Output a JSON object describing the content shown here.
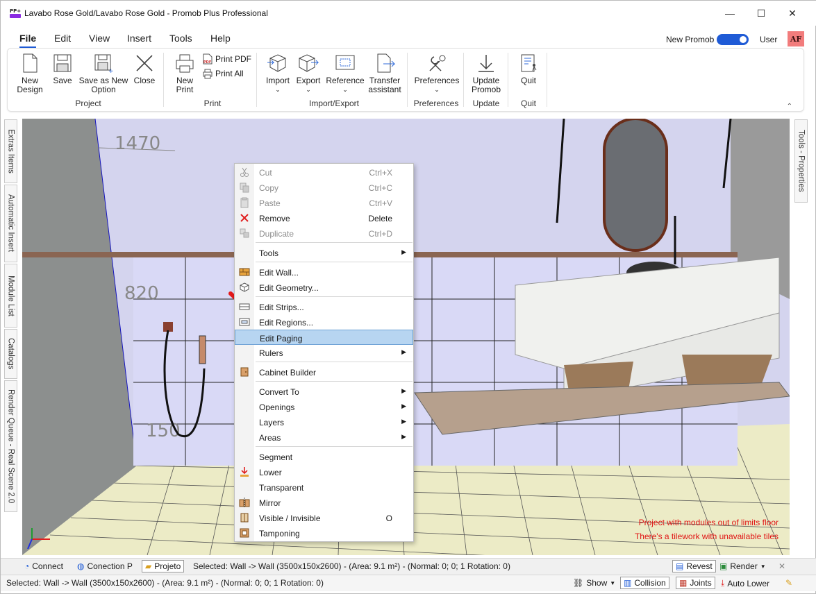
{
  "window": {
    "title": "Lavabo Rose Gold/Lavabo Rose Gold - Promob Plus Professional",
    "controls": {
      "minimize": "—",
      "maximize": "☐",
      "close": "✕"
    }
  },
  "menubar": {
    "items": [
      "File",
      "Edit",
      "View",
      "Insert",
      "Tools",
      "Help"
    ],
    "active": "File",
    "toggle_label": "New Promob",
    "toggle_on": true,
    "user_label": "User",
    "avatar_initials": "AF"
  },
  "ribbon": {
    "project": {
      "label": "Project",
      "new_design": [
        "New",
        "Design"
      ],
      "save": "Save",
      "save_as": [
        "Save as New",
        "Option"
      ],
      "close": "Close"
    },
    "print": {
      "label": "Print",
      "new_print": [
        "New",
        "Print"
      ],
      "print_pdf": "Print PDF",
      "print_all": "Print All"
    },
    "import_export": {
      "label": "Import/Export",
      "import": "Import",
      "export": "Export",
      "reference": "Reference",
      "transfer": [
        "Transfer",
        "assistant"
      ]
    },
    "preferences": {
      "label": "Preferences",
      "preferences": "Preferences"
    },
    "update": {
      "label": "Update",
      "update_promob": [
        "Update",
        "Promob"
      ]
    },
    "quit": {
      "label": "Quit",
      "quit": "Quit"
    }
  },
  "left_tabs": [
    "Extras Items",
    "Automatic Insert",
    "Module List",
    "Catalogs",
    "Render Queue - Real Scene 2.0"
  ],
  "right_tabs": [
    "Tools - Properties"
  ],
  "scene": {
    "dims": [
      "1470",
      "820",
      "150"
    ],
    "warnings": [
      "Project with modules out of limits floor",
      "There's a tilework with unavailable tiles"
    ]
  },
  "context_menu": {
    "cut": {
      "label": "Cut",
      "shortcut": "Ctrl+X"
    },
    "copy": {
      "label": "Copy",
      "shortcut": "Ctrl+C"
    },
    "paste": {
      "label": "Paste",
      "shortcut": "Ctrl+V"
    },
    "remove": {
      "label": "Remove",
      "shortcut": "Delete"
    },
    "duplicate": {
      "label": "Duplicate",
      "shortcut": "Ctrl+D"
    },
    "tools": "Tools",
    "edit_wall": "Edit Wall...",
    "edit_geometry": "Edit Geometry...",
    "edit_strips": "Edit Strips...",
    "edit_regions": "Edit Regions...",
    "edit_paging": "Edit Paging",
    "rulers": "Rulers",
    "cabinet_builder": "Cabinet Builder",
    "convert_to": "Convert To",
    "openings": "Openings",
    "layers": "Layers",
    "areas": "Areas",
    "segment": "Segment",
    "lower": "Lower",
    "transparent": "Transparent",
    "mirror": "Mirror",
    "visible_invisible": {
      "label": "Visible / Invisible",
      "shortcut": "O"
    },
    "tamponing": "Tamponing"
  },
  "statusbar": {
    "connect": "Connect",
    "conection": "Conection P",
    "projeto": "Projeto",
    "selected_top": "Selected: Wall -> Wall (3500x150x2600) - (Area: 9.1 m²) - (Normal: 0; 0; 1 Rotation: 0)",
    "revest": "Revest",
    "render": "Render",
    "selected_bottom": "Selected: Wall -> Wall (3500x150x2600) - (Area: 9.1 m²) - (Normal: 0; 0; 1 Rotation: 0)",
    "show": "Show",
    "collision": "Collision",
    "joints": "Joints",
    "auto_lower": "Auto Lower"
  }
}
